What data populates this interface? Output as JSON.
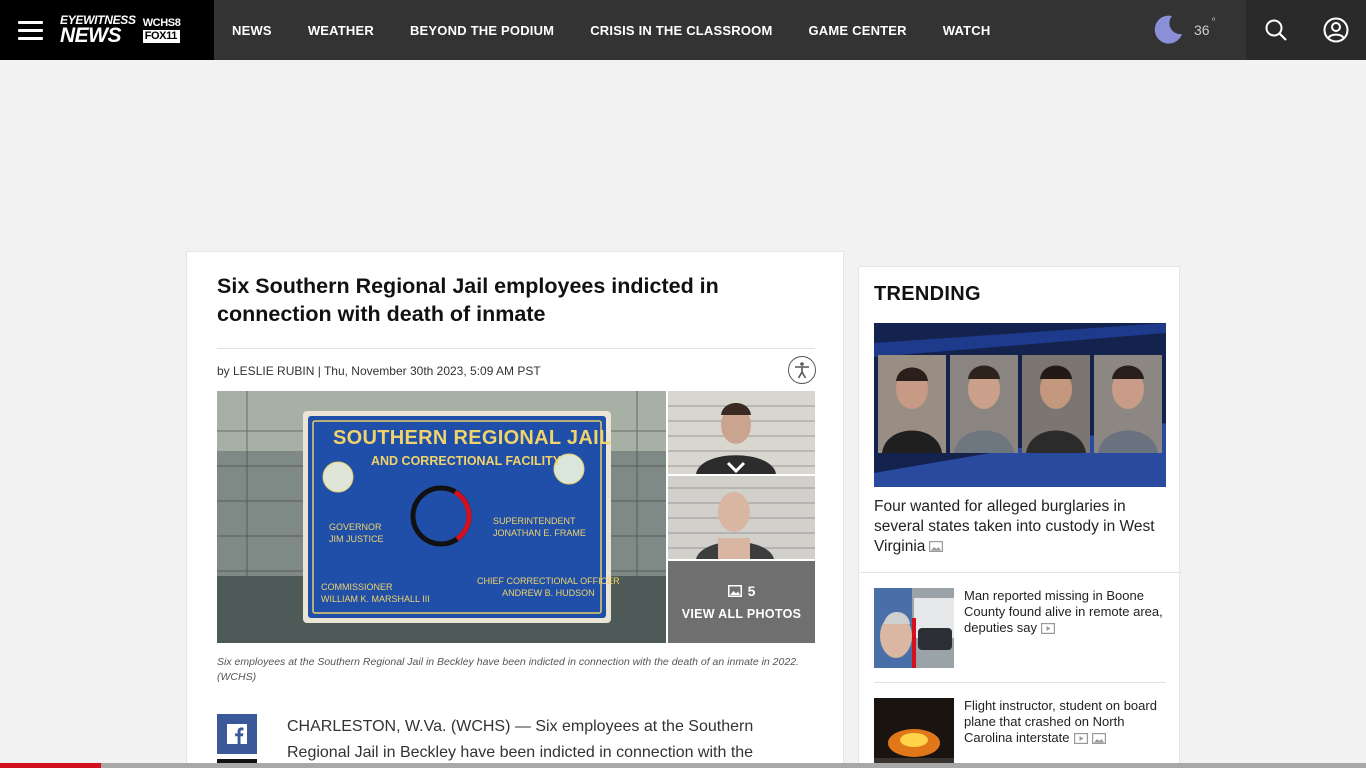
{
  "header": {
    "logo": {
      "line1": "EYEWITNESS",
      "line2": "NEWS",
      "station1": "WCHS",
      "station1_num": "8",
      "station2": "FOX",
      "station2_num": "11"
    },
    "nav": [
      "NEWS",
      "WEATHER",
      "BEYOND THE PODIUM",
      "CRISIS IN THE CLASSROOM",
      "GAME CENTER",
      "WATCH"
    ],
    "weather": {
      "temp": "36",
      "degree": "°"
    }
  },
  "article": {
    "headline": "Six Southern Regional Jail employees indicted in connection with death of inmate",
    "byline": "by LESLIE RUBIN | Thu, November 30th 2023, 5:09 AM PST",
    "hero_sign": {
      "line1": "SOUTHERN REGIONAL JAIL",
      "line2": "AND CORRECTIONAL FACILITY",
      "governor_title": "GOVERNOR",
      "governor_name": "JIM JUSTICE",
      "superintendent_title": "SUPERINTENDENT",
      "superintendent_name": "JONATHAN E. FRAME",
      "commissioner_title": "COMMISSIONER",
      "commissioner_name": "WILLIAM K. MARSHALL III",
      "cco_title": "CHIEF CORRECTIONAL OFFICER",
      "cco_name": "ANDREW B. HUDSON"
    },
    "photo_count": "5",
    "view_all": "VIEW ALL PHOTOS",
    "caption": "Six employees at the Southern Regional Jail in Beckley have been indicted in connection with the death of an inmate in 2022. (WCHS)",
    "body": "CHARLESTON, W.Va. (WCHS) — Six employees at the Southern Regional Jail in Beckley have been indicted in connection with the"
  },
  "trending": {
    "heading": "TRENDING",
    "top_story": "Four wanted for alleged burglaries in several states taken into custody in West Virginia",
    "items": [
      {
        "title": "Man reported missing in Boone County found alive in remote area, deputies say"
      },
      {
        "title": "Flight instructor, student on board plane that crashed on North Carolina interstate"
      }
    ]
  },
  "progress": {
    "read_fraction": 0.074
  },
  "colors": {
    "accent": "#d3101e",
    "header_bg": "#333333",
    "facebook": "#3b5998"
  }
}
